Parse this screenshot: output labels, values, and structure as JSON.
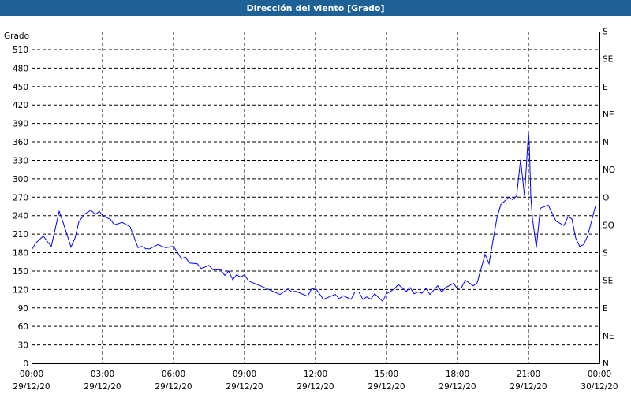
{
  "chart_data": {
    "type": "line",
    "title": "Dirección del viento [Grado]",
    "ylabel": "Grado",
    "ylim": [
      0,
      510
    ],
    "yticks": [
      0,
      30,
      60,
      90,
      120,
      150,
      180,
      210,
      240,
      270,
      300,
      330,
      360,
      390,
      420,
      450,
      480,
      510
    ],
    "right_axis": [
      {
        "value": 540,
        "label": "S"
      },
      {
        "value": 495,
        "label": "SE"
      },
      {
        "value": 450,
        "label": "E"
      },
      {
        "value": 405,
        "label": "NE"
      },
      {
        "value": 360,
        "label": "N"
      },
      {
        "value": 315,
        "label": "NO"
      },
      {
        "value": 270,
        "label": "O"
      },
      {
        "value": 225,
        "label": "SO"
      },
      {
        "value": 180,
        "label": "S"
      },
      {
        "value": 135,
        "label": "SE"
      },
      {
        "value": 90,
        "label": "E"
      },
      {
        "value": 45,
        "label": "NE"
      },
      {
        "value": 0,
        "label": "N"
      }
    ],
    "xlim_minutes": [
      0,
      1440
    ],
    "xticks": [
      {
        "minute": 0,
        "time": "00:00",
        "date": "29/12/20"
      },
      {
        "minute": 180,
        "time": "03:00",
        "date": "29/12/20"
      },
      {
        "minute": 360,
        "time": "06:00",
        "date": "29/12/20"
      },
      {
        "minute": 540,
        "time": "09:00",
        "date": "29/12/20"
      },
      {
        "minute": 720,
        "time": "12:00",
        "date": "29/12/20"
      },
      {
        "minute": 900,
        "time": "15:00",
        "date": "29/12/20"
      },
      {
        "minute": 1080,
        "time": "18:00",
        "date": "29/12/20"
      },
      {
        "minute": 1260,
        "time": "21:00",
        "date": "29/12/20"
      },
      {
        "minute": 1440,
        "time": "00:00",
        "date": "30/12/20"
      }
    ],
    "grid": true,
    "line_color": "#0000ff",
    "series": [
      {
        "name": "Dirección del viento",
        "x_minutes": [
          2,
          10,
          30,
          40,
          50,
          70,
          80,
          100,
          110,
          120,
          134,
          150,
          162,
          172,
          180,
          200,
          210,
          230,
          250,
          270,
          280,
          290,
          300,
          320,
          340,
          360,
          380,
          390,
          400,
          420,
          430,
          450,
          460,
          480,
          490,
          500,
          510,
          520,
          530,
          540,
          550,
          580,
          630,
          650,
          660,
          670,
          700,
          710,
          720,
          740,
          770,
          780,
          790,
          810,
          820,
          830,
          840,
          850,
          860,
          870,
          890,
          900,
          920,
          930,
          950,
          960,
          970,
          980,
          990,
          1000,
          1010,
          1030,
          1040,
          1050,
          1070,
          1080,
          1090,
          1100,
          1120,
          1130,
          1150,
          1160,
          1180,
          1190,
          1210,
          1220,
          1230,
          1240,
          1250,
          1260,
          1262,
          1266,
          1270,
          1280,
          1290,
          1310,
          1330,
          1350,
          1360,
          1370,
          1380,
          1390,
          1400,
          1410,
          1430
        ],
        "values": [
          186,
          195,
          207,
          198,
          190,
          247,
          229,
          189,
          203,
          230,
          242,
          249,
          242,
          247,
          240,
          234,
          225,
          229,
          222,
          188,
          190,
          186,
          186,
          193,
          188,
          190,
          170,
          173,
          163,
          162,
          154,
          159,
          152,
          152,
          143,
          150,
          136,
          144,
          140,
          144,
          134,
          126,
          112,
          121,
          116,
          117,
          109,
          121,
          122,
          104,
          112,
          105,
          110,
          104,
          116,
          116,
          104,
          108,
          104,
          113,
          101,
          113,
          121,
          128,
          117,
          123,
          113,
          116,
          114,
          122,
          112,
          126,
          116,
          123,
          130,
          121,
          123,
          135,
          126,
          131,
          177,
          162,
          236,
          258,
          270,
          266,
          272,
          331,
          272,
          376,
          358,
          271,
          236,
          188,
          252,
          257,
          231,
          224,
          238,
          235,
          203,
          190,
          193,
          207,
          256
        ]
      }
    ]
  }
}
